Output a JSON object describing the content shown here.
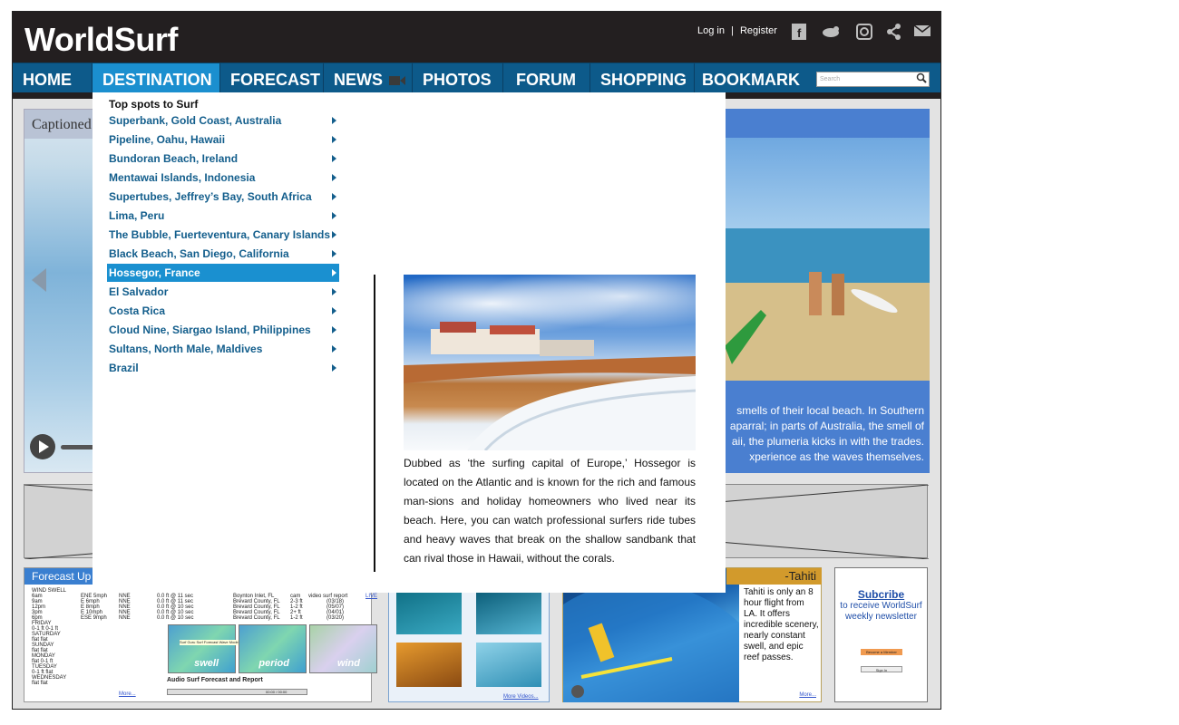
{
  "header": {
    "logo": "WorldSurf",
    "login": "Log in",
    "separator": "|",
    "register": "Register",
    "social_icons": [
      "facebook-icon",
      "twitter-icon",
      "instagram-icon",
      "share-icon",
      "mail-icon"
    ]
  },
  "nav": {
    "items": [
      "HOME",
      "DESTINATION",
      "FORECAST",
      "NEWS",
      "PHOTOS",
      "FORUM",
      "SHOPPING",
      "BOOKMARK"
    ],
    "active": "DESTINATION",
    "search_placeholder": "Search"
  },
  "slider": {
    "caption": "Captioned"
  },
  "feature": {
    "text": "smells of their local beach. In Southern aparral; in parts of Australia, the smell of aii, the plumeria kicks in with the trades. xperience as the waves themselves."
  },
  "forecast": {
    "title": "Forecast Up",
    "col1": [
      "WIND   SWELL",
      "6am",
      "9am",
      "12pm",
      "3pm",
      "6pm",
      "FRIDAY",
      "0-1 ft   0-1 ft",
      "SATURDAY",
      "flat     flat",
      "SUNDAY",
      "flat     flat",
      "MONDAY",
      "flat     0-1 ft",
      "TUESDAY",
      "0-1 ft   flat",
      "WEDNESDAY",
      "flat     flat"
    ],
    "col2": [
      "ENE 5mph",
      "E 6mph",
      "E 8mph",
      "E 10mph",
      "ESE 9mph"
    ],
    "col3": [
      "NNE",
      "NNE",
      "NNE",
      "NNE",
      "NNE"
    ],
    "col4": [
      "0.0 ft @ 11 sec",
      "0.0 ft @ 11 sec",
      "0.0 ft @ 10 sec",
      "0.0 ft @ 10 sec",
      "0.0 ft @ 10 sec"
    ],
    "col5": [
      "Boynton Inlet, FL",
      "Brevard County, FL",
      "Brevard County, FL",
      "Brevard County, FL",
      "Brevard County, FL"
    ],
    "col6": [
      "cam",
      "2-3 ft",
      "1-2 ft",
      "2+ ft",
      "1-2 ft"
    ],
    "col7": [
      "video surf report",
      "(03/18)",
      "(05/07)",
      "(04/01)",
      "(03/20)"
    ],
    "live": "LIVE",
    "map_labels": [
      "swell",
      "period",
      "wind"
    ],
    "map_caption": "Surf Guru Surf Forecast Wave Model",
    "audio_title": "Audio Surf Forecast and Report",
    "audio_time": "00:00 / 00:00",
    "more": "More..."
  },
  "videos": {
    "more": "More Videos..."
  },
  "tahiti": {
    "title": "-Tahiti",
    "text": "Tahiti is only an 8 hour flight from LA. It offers incredible scenery, nearly constant swell, and epic reef passes.",
    "more": "More..."
  },
  "newsletter": {
    "subscribe": "Subcribe",
    "text": "to receive WorldSurf weekly newsletter",
    "btn1": "Become a Member",
    "btn2": "Sign In"
  },
  "dropdown": {
    "heading": "Top spots to Surf",
    "items": [
      "Superbank, Gold Coast, Australia",
      "Pipeline, Oahu, Hawaii",
      "Bundoran Beach, Ireland",
      "Mentawai Islands, Indonesia",
      "Supertubes, Jeffrey’s Bay, South Africa",
      "Lima, Peru",
      "The Bubble, Fuerteventura, Canary Islands",
      "Black Beach, San Diego, California",
      "Hossegor, France",
      "El Salvador",
      "Costa Rica",
      "Cloud Nine, Siargao Island, Philippines",
      "Sultans, North Male, Maldives",
      "Brazil"
    ],
    "active": "Hossegor, France",
    "description": "Dubbed as ‘the surfing capital of Europe,’ Hossegor is located on the Atlantic and is known for the rich and famous man-sions and holiday homeowners who lived near its beach. Here, you can watch professional surfers ride tubes and heavy waves that break on the shallow sandbank that can rival those in Hawaii, without the corals."
  },
  "colors": {
    "topbar": "#231f20",
    "nav": "#0d5a8a",
    "nav_active": "#1b8fcf",
    "link": "#135e8c"
  }
}
